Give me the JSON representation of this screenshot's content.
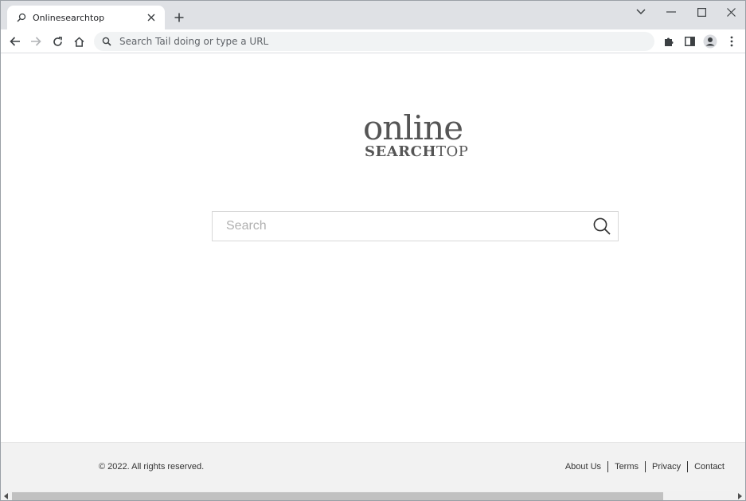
{
  "browser": {
    "tab": {
      "title": "Onlinesearchtop"
    },
    "omnibox": {
      "placeholder": "Search Tail doing or type a URL"
    }
  },
  "page": {
    "logo": {
      "top": "online",
      "bottom_bold": "SEARCH",
      "bottom_light": "TOP"
    },
    "search": {
      "placeholder": "Search"
    }
  },
  "footer": {
    "copyright": "© 2022. All rights reserved.",
    "links": [
      "About Us",
      "Terms",
      "Privacy",
      "Contact"
    ]
  },
  "icons": {
    "tab_icon": "search-icon",
    "tab_close": "close-icon",
    "new_tab": "plus-icon",
    "back": "back-arrow-icon",
    "forward": "forward-arrow-icon",
    "reload": "reload-icon",
    "home": "home-icon",
    "omnibox": "search-icon",
    "extensions": "puzzle-icon",
    "side_panel": "side-panel-icon",
    "profile": "profile-icon",
    "menu": "kebab-menu-icon",
    "search_button": "magnifier-icon"
  }
}
